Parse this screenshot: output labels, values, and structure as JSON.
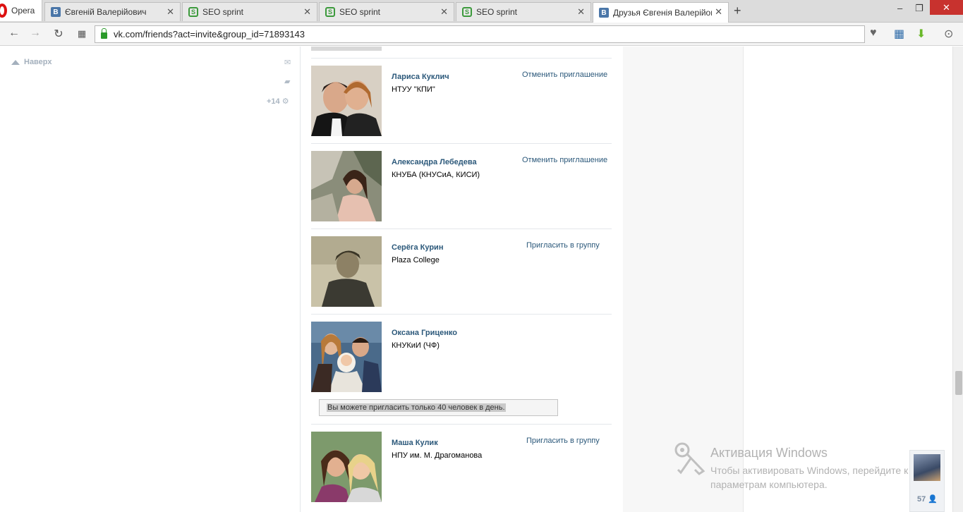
{
  "browser": {
    "opera_label": "Opera",
    "tabs": [
      {
        "title": "Євгеній Валерійович",
        "favicon": "vk-icon",
        "active": false
      },
      {
        "title": "SEO sprint",
        "favicon": "seo-sprint-icon",
        "active": false
      },
      {
        "title": "SEO sprint",
        "favicon": "seo-sprint-icon",
        "active": false
      },
      {
        "title": "SEO sprint",
        "favicon": "seo-sprint-icon",
        "active": false
      },
      {
        "title": "Друзья Євгенія Валерійовича",
        "favicon": "vk-icon",
        "active": true
      }
    ],
    "close_glyph": "✕",
    "new_tab_glyph": "+",
    "minimize_glyph": "‒",
    "restore_glyph": "❐",
    "window_close_glyph": "✕",
    "url": "vk.com/friends?act=invite&group_id=71893143"
  },
  "sidebar": {
    "top_link": "Наверх",
    "counter": "+14"
  },
  "friends": [
    {
      "name": "Лариса Куклич",
      "school": "НТУУ \"КПИ\"",
      "action": "Отменить приглашение"
    },
    {
      "name": "Александра Лебедева",
      "school": "КНУБА (КНУСиА, КИСИ)",
      "action": "Отменить приглашение"
    },
    {
      "name": "Серёга Курин",
      "school": "Plaza College",
      "action": "Пригласить в группу"
    },
    {
      "name": "Оксана Гриценко",
      "school": "КНУКиИ (ЧФ)",
      "action": ""
    },
    {
      "name": "Маша Кулик",
      "school": "НПУ им. М. Драгоманова",
      "action": "Пригласить в группу"
    }
  ],
  "notice": "Вы можете пригласить только 40 человек в день.",
  "watermark": {
    "title": "Активация Windows",
    "subtitle": "Чтобы активировать Windows, перейдите к параметрам компьютера."
  },
  "chat": {
    "count": "57"
  },
  "colors": {
    "link": "#2b587a",
    "vk_blue": "#4a76a8"
  }
}
